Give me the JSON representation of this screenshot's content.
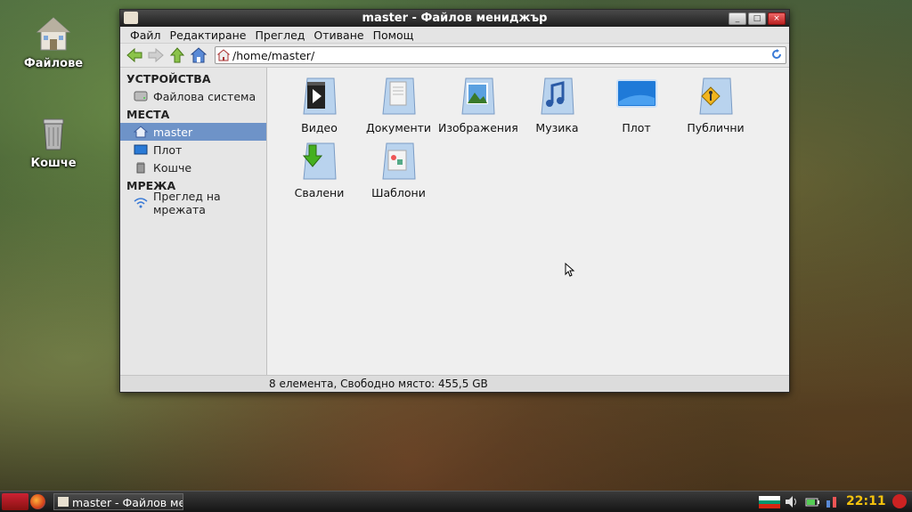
{
  "desktop": {
    "icons": [
      {
        "label": "Файлове",
        "icon": "home-folder-icon"
      },
      {
        "label": "Кошче",
        "icon": "trash-icon"
      }
    ]
  },
  "window": {
    "title": "master - Файлов мениджър",
    "menu": [
      "Файл",
      "Редактиране",
      "Преглед",
      "Отиване",
      "Помощ"
    ],
    "location": "/home/master/",
    "sidebar": {
      "devices_header": "УСТРОЙСТВА",
      "devices": [
        {
          "label": "Файлова система",
          "icon": "harddrive-icon"
        }
      ],
      "places_header": "МЕСТА",
      "places": [
        {
          "label": "master",
          "icon": "home-icon"
        },
        {
          "label": "Плот",
          "icon": "desktop-icon"
        },
        {
          "label": "Кошче",
          "icon": "trash-icon"
        }
      ],
      "network_header": "МРЕЖА",
      "network": [
        {
          "label": "Преглед на мрежата",
          "icon": "wifi-icon"
        }
      ]
    },
    "files": [
      {
        "name": "Видео",
        "icon": "video-folder-icon"
      },
      {
        "name": "Документи",
        "icon": "documents-folder-icon"
      },
      {
        "name": "Изображения",
        "icon": "pictures-folder-icon"
      },
      {
        "name": "Музика",
        "icon": "music-folder-icon"
      },
      {
        "name": "Плот",
        "icon": "desktop-folder-icon"
      },
      {
        "name": "Публични",
        "icon": "public-folder-icon"
      },
      {
        "name": "Свалени",
        "icon": "downloads-folder-icon"
      },
      {
        "name": "Шаблони",
        "icon": "templates-folder-icon"
      }
    ],
    "status": "8 елемента, Свободно място: 455,5 GB"
  },
  "taskbar": {
    "task_label": "master - Файлов мен...",
    "clock": "22:11"
  },
  "colors": {
    "selection": "#6e93c8",
    "clock": "#f4c20d"
  }
}
